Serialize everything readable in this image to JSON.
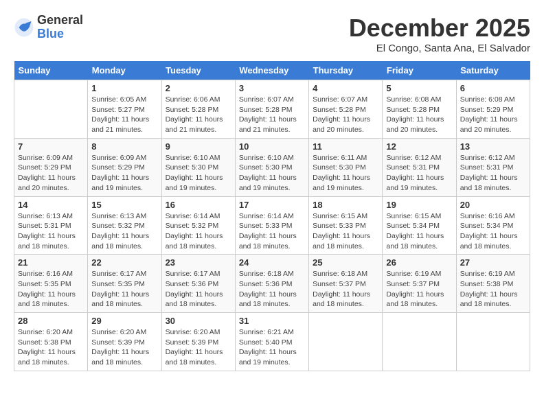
{
  "logo": {
    "general": "General",
    "blue": "Blue"
  },
  "title": "December 2025",
  "location": "El Congo, Santa Ana, El Salvador",
  "days_header": [
    "Sunday",
    "Monday",
    "Tuesday",
    "Wednesday",
    "Thursday",
    "Friday",
    "Saturday"
  ],
  "weeks": [
    [
      {
        "day": "",
        "sunrise": "",
        "sunset": "",
        "daylight": "",
        "empty": true
      },
      {
        "day": "1",
        "sunrise": "Sunrise: 6:05 AM",
        "sunset": "Sunset: 5:27 PM",
        "daylight": "Daylight: 11 hours and 21 minutes."
      },
      {
        "day": "2",
        "sunrise": "Sunrise: 6:06 AM",
        "sunset": "Sunset: 5:28 PM",
        "daylight": "Daylight: 11 hours and 21 minutes."
      },
      {
        "day": "3",
        "sunrise": "Sunrise: 6:07 AM",
        "sunset": "Sunset: 5:28 PM",
        "daylight": "Daylight: 11 hours and 21 minutes."
      },
      {
        "day": "4",
        "sunrise": "Sunrise: 6:07 AM",
        "sunset": "Sunset: 5:28 PM",
        "daylight": "Daylight: 11 hours and 20 minutes."
      },
      {
        "day": "5",
        "sunrise": "Sunrise: 6:08 AM",
        "sunset": "Sunset: 5:28 PM",
        "daylight": "Daylight: 11 hours and 20 minutes."
      },
      {
        "day": "6",
        "sunrise": "Sunrise: 6:08 AM",
        "sunset": "Sunset: 5:29 PM",
        "daylight": "Daylight: 11 hours and 20 minutes."
      }
    ],
    [
      {
        "day": "7",
        "sunrise": "Sunrise: 6:09 AM",
        "sunset": "Sunset: 5:29 PM",
        "daylight": "Daylight: 11 hours and 20 minutes."
      },
      {
        "day": "8",
        "sunrise": "Sunrise: 6:09 AM",
        "sunset": "Sunset: 5:29 PM",
        "daylight": "Daylight: 11 hours and 19 minutes."
      },
      {
        "day": "9",
        "sunrise": "Sunrise: 6:10 AM",
        "sunset": "Sunset: 5:30 PM",
        "daylight": "Daylight: 11 hours and 19 minutes."
      },
      {
        "day": "10",
        "sunrise": "Sunrise: 6:10 AM",
        "sunset": "Sunset: 5:30 PM",
        "daylight": "Daylight: 11 hours and 19 minutes."
      },
      {
        "day": "11",
        "sunrise": "Sunrise: 6:11 AM",
        "sunset": "Sunset: 5:30 PM",
        "daylight": "Daylight: 11 hours and 19 minutes."
      },
      {
        "day": "12",
        "sunrise": "Sunrise: 6:12 AM",
        "sunset": "Sunset: 5:31 PM",
        "daylight": "Daylight: 11 hours and 19 minutes."
      },
      {
        "day": "13",
        "sunrise": "Sunrise: 6:12 AM",
        "sunset": "Sunset: 5:31 PM",
        "daylight": "Daylight: 11 hours and 18 minutes."
      }
    ],
    [
      {
        "day": "14",
        "sunrise": "Sunrise: 6:13 AM",
        "sunset": "Sunset: 5:31 PM",
        "daylight": "Daylight: 11 hours and 18 minutes."
      },
      {
        "day": "15",
        "sunrise": "Sunrise: 6:13 AM",
        "sunset": "Sunset: 5:32 PM",
        "daylight": "Daylight: 11 hours and 18 minutes."
      },
      {
        "day": "16",
        "sunrise": "Sunrise: 6:14 AM",
        "sunset": "Sunset: 5:32 PM",
        "daylight": "Daylight: 11 hours and 18 minutes."
      },
      {
        "day": "17",
        "sunrise": "Sunrise: 6:14 AM",
        "sunset": "Sunset: 5:33 PM",
        "daylight": "Daylight: 11 hours and 18 minutes."
      },
      {
        "day": "18",
        "sunrise": "Sunrise: 6:15 AM",
        "sunset": "Sunset: 5:33 PM",
        "daylight": "Daylight: 11 hours and 18 minutes."
      },
      {
        "day": "19",
        "sunrise": "Sunrise: 6:15 AM",
        "sunset": "Sunset: 5:34 PM",
        "daylight": "Daylight: 11 hours and 18 minutes."
      },
      {
        "day": "20",
        "sunrise": "Sunrise: 6:16 AM",
        "sunset": "Sunset: 5:34 PM",
        "daylight": "Daylight: 11 hours and 18 minutes."
      }
    ],
    [
      {
        "day": "21",
        "sunrise": "Sunrise: 6:16 AM",
        "sunset": "Sunset: 5:35 PM",
        "daylight": "Daylight: 11 hours and 18 minutes."
      },
      {
        "day": "22",
        "sunrise": "Sunrise: 6:17 AM",
        "sunset": "Sunset: 5:35 PM",
        "daylight": "Daylight: 11 hours and 18 minutes."
      },
      {
        "day": "23",
        "sunrise": "Sunrise: 6:17 AM",
        "sunset": "Sunset: 5:36 PM",
        "daylight": "Daylight: 11 hours and 18 minutes."
      },
      {
        "day": "24",
        "sunrise": "Sunrise: 6:18 AM",
        "sunset": "Sunset: 5:36 PM",
        "daylight": "Daylight: 11 hours and 18 minutes."
      },
      {
        "day": "25",
        "sunrise": "Sunrise: 6:18 AM",
        "sunset": "Sunset: 5:37 PM",
        "daylight": "Daylight: 11 hours and 18 minutes."
      },
      {
        "day": "26",
        "sunrise": "Sunrise: 6:19 AM",
        "sunset": "Sunset: 5:37 PM",
        "daylight": "Daylight: 11 hours and 18 minutes."
      },
      {
        "day": "27",
        "sunrise": "Sunrise: 6:19 AM",
        "sunset": "Sunset: 5:38 PM",
        "daylight": "Daylight: 11 hours and 18 minutes."
      }
    ],
    [
      {
        "day": "28",
        "sunrise": "Sunrise: 6:20 AM",
        "sunset": "Sunset: 5:38 PM",
        "daylight": "Daylight: 11 hours and 18 minutes."
      },
      {
        "day": "29",
        "sunrise": "Sunrise: 6:20 AM",
        "sunset": "Sunset: 5:39 PM",
        "daylight": "Daylight: 11 hours and 18 minutes."
      },
      {
        "day": "30",
        "sunrise": "Sunrise: 6:20 AM",
        "sunset": "Sunset: 5:39 PM",
        "daylight": "Daylight: 11 hours and 18 minutes."
      },
      {
        "day": "31",
        "sunrise": "Sunrise: 6:21 AM",
        "sunset": "Sunset: 5:40 PM",
        "daylight": "Daylight: 11 hours and 19 minutes."
      },
      {
        "day": "",
        "sunrise": "",
        "sunset": "",
        "daylight": "",
        "empty": true
      },
      {
        "day": "",
        "sunrise": "",
        "sunset": "",
        "daylight": "",
        "empty": true
      },
      {
        "day": "",
        "sunrise": "",
        "sunset": "",
        "daylight": "",
        "empty": true
      }
    ]
  ]
}
